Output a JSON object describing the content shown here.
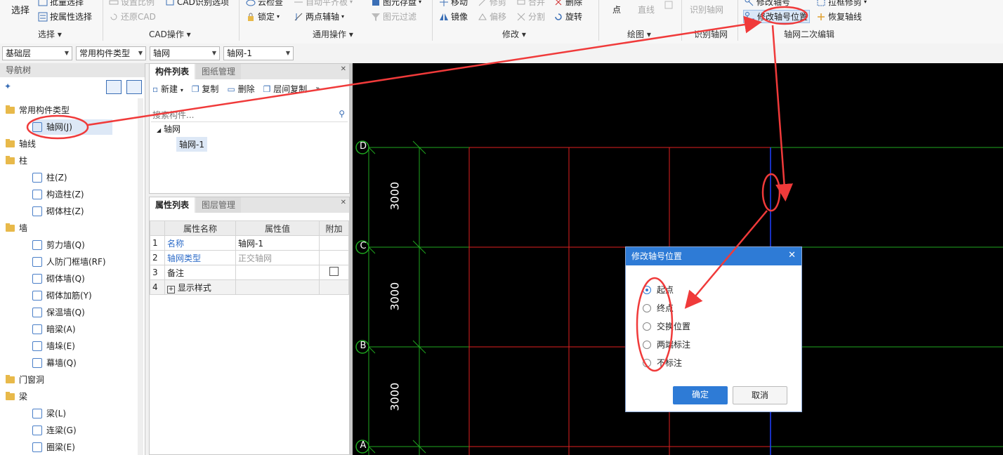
{
  "ribbon": {
    "select_big": "选择",
    "batch_select": "批量选择",
    "attr_select": "按属性选择",
    "set_ratio": "设置比例",
    "restore_cad": "还原CAD",
    "cad_recognize_options": "CAD识别选项",
    "cloud_check": "云检查",
    "auto_level": "自动平齐板",
    "lock": "锁定",
    "two_point_aux": "两点辅轴",
    "element_save": "图元存盘",
    "element_filter": "图元过滤",
    "move": "移动",
    "trim": "修剪",
    "merge": "合并",
    "delete": "删除",
    "mirror": "镜像",
    "offset": "偏移",
    "split": "分割",
    "rotate": "旋转",
    "point": "点",
    "line": "直线",
    "recognize_axis": "识别轴网",
    "modify_axis_no": "修改轴号",
    "modify_axis_pos": "修改轴号位置",
    "box_trim": "拉框修剪",
    "restore_axis": "恢复轴线",
    "groups": [
      "选择",
      "CAD操作",
      "通用操作",
      "修改",
      "绘图",
      "识别轴网",
      "轴网二次编辑"
    ]
  },
  "selectors": [
    "基础层",
    "常用构件类型",
    "轴网",
    "轴网-1"
  ],
  "nav": {
    "title": "导航树",
    "items": [
      {
        "label": "常用构件类型",
        "type": "folder"
      },
      {
        "label": "轴网(J)",
        "type": "child"
      },
      {
        "label": "轴线",
        "type": "folder"
      },
      {
        "label": "柱",
        "type": "folder"
      },
      {
        "label": "柱(Z)",
        "type": "child"
      },
      {
        "label": "构造柱(Z)",
        "type": "child"
      },
      {
        "label": "砌体柱(Z)",
        "type": "child"
      },
      {
        "label": "墙",
        "type": "folder"
      },
      {
        "label": "剪力墙(Q)",
        "type": "child"
      },
      {
        "label": "人防门框墙(RF)",
        "type": "child"
      },
      {
        "label": "砌体墙(Q)",
        "type": "child"
      },
      {
        "label": "砌体加筋(Y)",
        "type": "child"
      },
      {
        "label": "保温墙(Q)",
        "type": "child"
      },
      {
        "label": "暗梁(A)",
        "type": "child"
      },
      {
        "label": "墙垛(E)",
        "type": "child"
      },
      {
        "label": "幕墙(Q)",
        "type": "child"
      },
      {
        "label": "门窗洞",
        "type": "folder"
      },
      {
        "label": "梁",
        "type": "folder"
      },
      {
        "label": "梁(L)",
        "type": "child"
      },
      {
        "label": "连梁(G)",
        "type": "child"
      },
      {
        "label": "圈梁(E)",
        "type": "child"
      }
    ]
  },
  "component_panel": {
    "tabs": [
      "构件列表",
      "图纸管理"
    ],
    "toolbar": {
      "new": "新建",
      "copy": "复制",
      "delete": "删除",
      "floor_copy": "层间复制"
    },
    "search_placeholder": "搜索构件...",
    "tree_root": "轴网",
    "tree_child": "轴网-1"
  },
  "property_panel": {
    "tabs": [
      "属性列表",
      "图层管理"
    ],
    "headers": [
      "",
      "属性名称",
      "属性值",
      "附加"
    ],
    "rows": [
      {
        "num": "1",
        "name": "名称",
        "value": "轴网-1"
      },
      {
        "num": "2",
        "name": "轴网类型",
        "value": "正交轴网"
      },
      {
        "num": "3",
        "name": "备注",
        "value": ""
      },
      {
        "num": "4",
        "name": "显示样式",
        "value": ""
      }
    ]
  },
  "canvas": {
    "axis_labels": [
      "D",
      "C",
      "B",
      "A"
    ],
    "dimensions": [
      "3000",
      "3000",
      "3000"
    ]
  },
  "dialog": {
    "title": "修改轴号位置",
    "options": [
      "起点",
      "终点",
      "交换位置",
      "两端标注",
      "不标注"
    ],
    "selected_index": 0,
    "ok": "确定",
    "cancel": "取消"
  },
  "colors": {
    "accent": "#2e7bd6",
    "annotation": "#f03a3a",
    "grid_green": "#1fa81f",
    "grid_red": "#e02020",
    "grid_blue": "#2040ff"
  }
}
